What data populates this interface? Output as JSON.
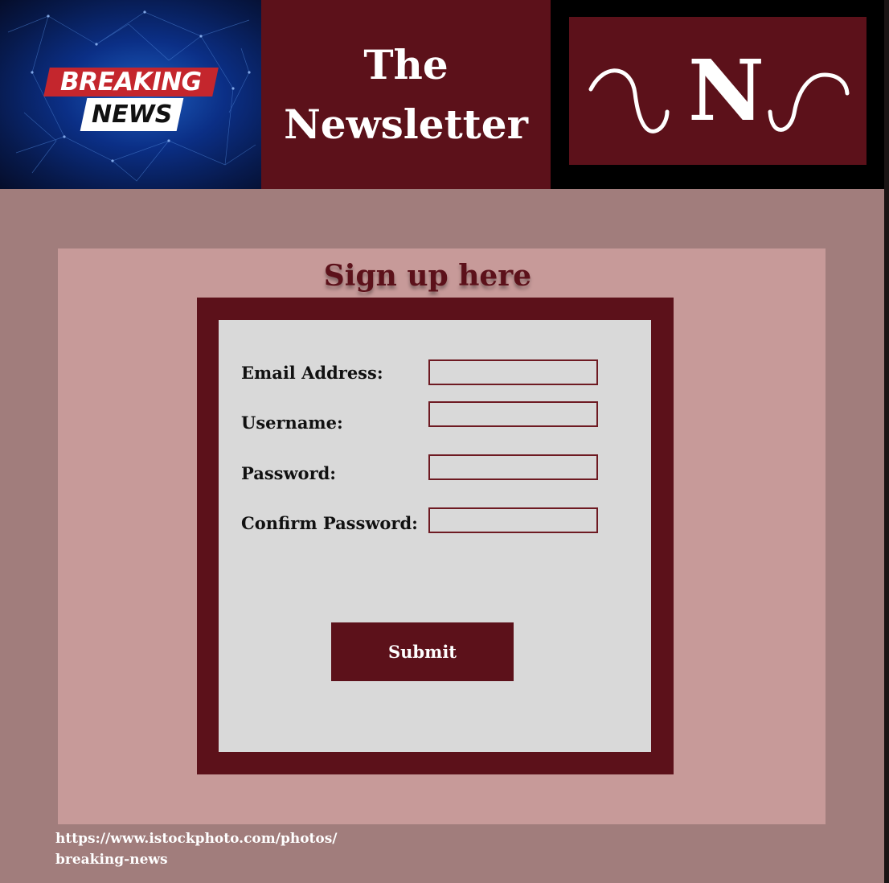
{
  "header": {
    "banner": {
      "line1": "BREAKING",
      "line2": "NEWS"
    },
    "title": {
      "line1": "The",
      "line2": "Newsletter"
    },
    "logo_letter": "N"
  },
  "signup": {
    "heading": "Sign up here",
    "fields": [
      {
        "label": "Email Address:",
        "value": ""
      },
      {
        "label": "Username:",
        "value": ""
      },
      {
        "label": "Password:",
        "value": ""
      },
      {
        "label": "Confirm Password:",
        "value": ""
      }
    ],
    "submit_label": "Submit"
  },
  "footer": {
    "source_line1": "https://www.istockphoto.com/photos/",
    "source_line2": "breaking-news"
  },
  "colors": {
    "maroon": "#5c111a",
    "page_background": "#a17d7c",
    "panel_background": "#c79a99",
    "form_background": "#d9d9d9"
  }
}
